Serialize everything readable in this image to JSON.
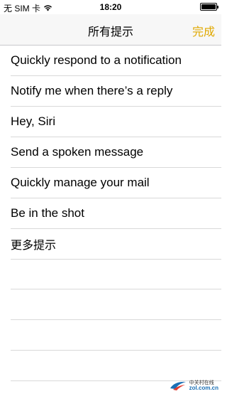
{
  "status_bar": {
    "carrier": "无 SIM 卡",
    "time": "18:20",
    "battery_level": 1.0
  },
  "nav": {
    "title": "所有提示",
    "done_label": "完成",
    "accent_color": "#e0a800"
  },
  "tips": [
    {
      "label": "Quickly respond to a notification"
    },
    {
      "label": "Notify me when there’s a reply"
    },
    {
      "label": "Hey, Siri"
    },
    {
      "label": "Send a spoken message"
    },
    {
      "label": "Quickly manage your mail"
    },
    {
      "label": "Be in the shot"
    }
  ],
  "more_tips_label": "更多提示",
  "watermark": {
    "brand": "中关村在线",
    "url": "zol.com.cn"
  }
}
